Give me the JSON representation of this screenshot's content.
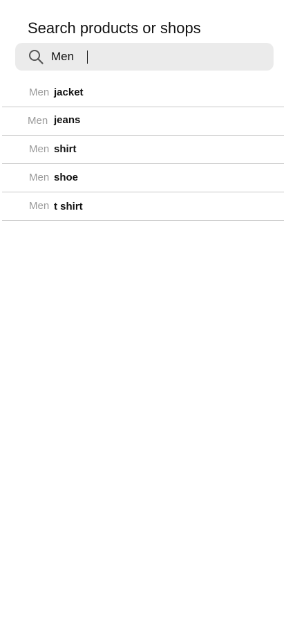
{
  "header": {
    "title": "Search products or shops"
  },
  "search": {
    "value": "Men",
    "icon": "search-icon"
  },
  "suggestions": [
    {
      "prefix": "Men",
      "rest": "jacket"
    },
    {
      "prefix": "Men",
      "rest": "jeans"
    },
    {
      "prefix": "Men",
      "rest": "shirt"
    },
    {
      "prefix": "Men",
      "rest": "shoe"
    },
    {
      "prefix": "Men",
      "rest": "t shirt"
    }
  ],
  "colors": {
    "search_background": "#ebebeb",
    "muted_text": "#9a9a9a",
    "divider": "#c8c8c8"
  }
}
